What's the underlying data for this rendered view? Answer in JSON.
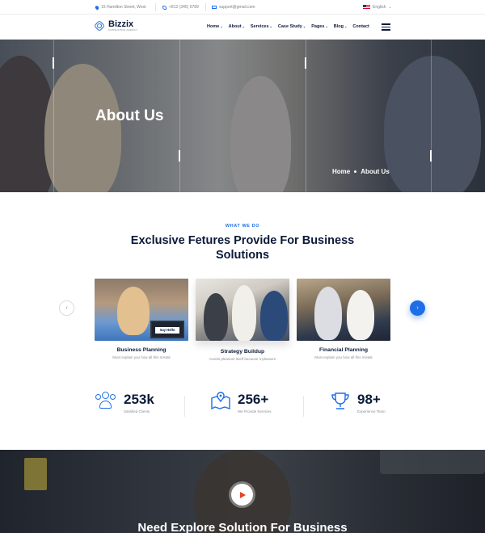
{
  "topbar": {
    "address": "15 Hamilton Street, West",
    "phone": "+812 (345) 6789",
    "email": "support@gmail.com",
    "language": "English"
  },
  "header": {
    "brand": "Bizzix",
    "tagline": "CONSULTING AGENCY",
    "nav": [
      {
        "label": "Home",
        "dropdown": true
      },
      {
        "label": "About",
        "dropdown": true
      },
      {
        "label": "Services",
        "dropdown": true
      },
      {
        "label": "Case Study",
        "dropdown": true
      },
      {
        "label": "Pages",
        "dropdown": true
      },
      {
        "label": "Blog",
        "dropdown": true
      },
      {
        "label": "Contact",
        "dropdown": false
      }
    ]
  },
  "hero": {
    "title": "About Us",
    "breadcrumb_home": "Home",
    "breadcrumb_current": "About Us"
  },
  "features": {
    "eyebrow": "WHAT WE DO",
    "title": "Exclusive Fetures Provide For Business Solutions",
    "cards": [
      {
        "title": "Business Planning",
        "text": "Must explain you how all this mistak",
        "badge": "Say Hello"
      },
      {
        "title": "Strategy Buildup",
        "text": "Avoids pleasure itself because it pleasure"
      },
      {
        "title": "Financial Planning",
        "text": "Must explain you how all this mistak"
      }
    ]
  },
  "stats": [
    {
      "value": "253k",
      "label": "Satisfied Clients",
      "icon": "users-icon"
    },
    {
      "value": "256+",
      "label": "We Provide Services",
      "icon": "map-icon"
    },
    {
      "value": "98+",
      "label": "Experience Team",
      "icon": "trophy-icon"
    }
  ],
  "cta": {
    "title": "Need Explore Solution For Business"
  },
  "colors": {
    "accent": "#1e6ee8",
    "dark": "#0b1b3a",
    "play": "#e8402a"
  }
}
